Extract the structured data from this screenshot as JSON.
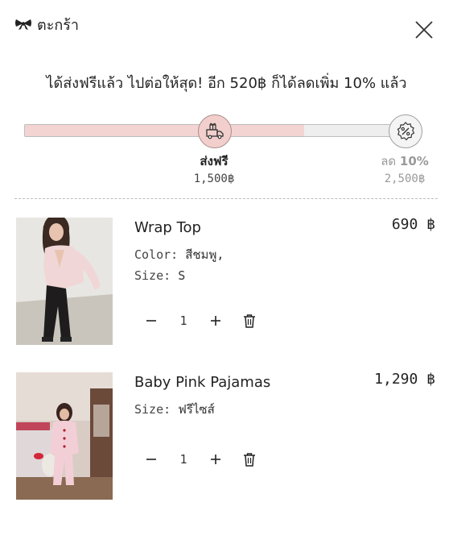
{
  "header": {
    "title": "ตะกร้า",
    "logo_icon": "bow-icon",
    "close_icon": "close-icon"
  },
  "promo": {
    "message": "ได้ส่งฟรีแล้ว ไปต่อให้สุด! อีก 520฿ ก็ได้ลดเพิ่ม 10% แล้ว"
  },
  "progress": {
    "fill_fraction": 0.72,
    "milestones": [
      {
        "title": "ส่งฟรี",
        "value": "1,500฿",
        "icon": "gift-truck-icon",
        "reached": true
      },
      {
        "title_prefix": "ลด",
        "title_bold": "10%",
        "value": "2,500฿",
        "icon": "percent-badge-icon",
        "reached": false
      }
    ]
  },
  "items": [
    {
      "name": "Wrap Top",
      "price": "690 ฿",
      "attributes": [
        {
          "key": "Color:",
          "value": "สีชมพู,"
        },
        {
          "key": "Size:",
          "value": "S"
        }
      ],
      "quantity": "1"
    },
    {
      "name": "Baby Pink Pajamas",
      "price": "1,290 ฿",
      "attributes": [
        {
          "key": "Size:",
          "value": "ฟรีไซส์"
        }
      ],
      "quantity": "1"
    }
  ],
  "colors": {
    "progress_fill": "#f3d4d2",
    "reached_badge": "#f2cfcc",
    "text": "#222222"
  }
}
